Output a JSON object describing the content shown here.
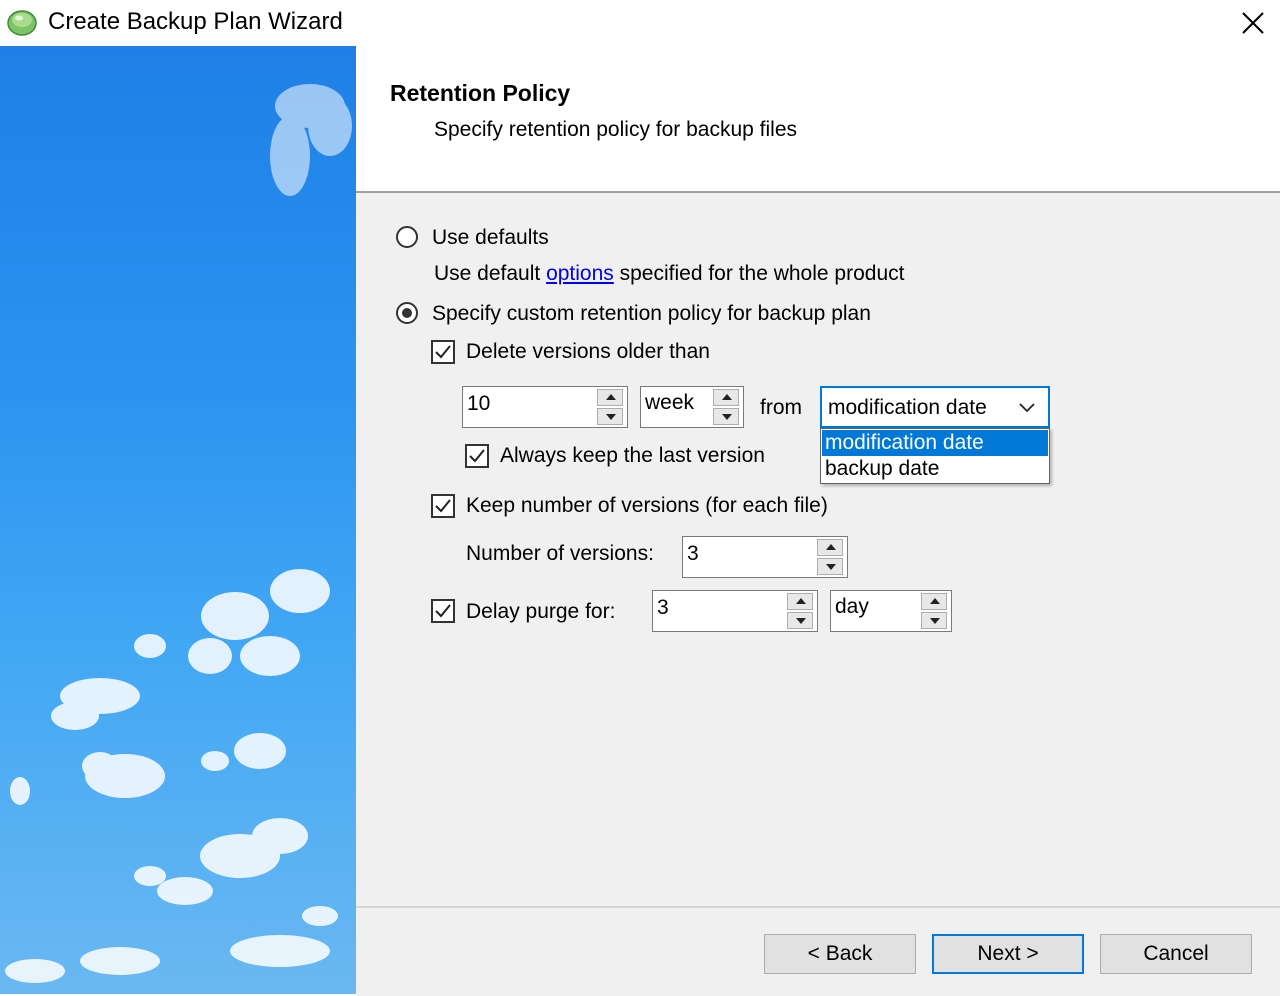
{
  "window": {
    "title": "Create Backup Plan Wizard",
    "close_icon": "close-icon"
  },
  "header": {
    "title": "Retention Policy",
    "subtitle": "Specify retention policy for backup files"
  },
  "retention": {
    "use_defaults_label": "Use defaults",
    "defaults_desc_prefix": "Use default ",
    "defaults_desc_link": "options",
    "defaults_desc_suffix": " specified for the whole product",
    "custom_label": "Specify custom retention policy for backup plan",
    "selected_option": "custom",
    "delete_versions": {
      "checked": true,
      "label": "Delete versions older than",
      "value": "10",
      "unit": "week",
      "from_label": "from",
      "from_value": "modification date"
    },
    "from_options": [
      "modification date",
      "backup date"
    ],
    "from_highlighted": "modification date",
    "keep_last": {
      "checked": true,
      "label": "Always keep the last version"
    },
    "keep_number": {
      "checked": true,
      "label": "Keep number of versions (for each file)",
      "count_label": "Number of versions:",
      "count_value": "3"
    },
    "delay_purge": {
      "checked": true,
      "label": "Delay purge for:",
      "value": "3",
      "unit": "day"
    }
  },
  "footer": {
    "back_label": "< Back",
    "next_label": "Next >",
    "cancel_label": "Cancel"
  },
  "colors": {
    "accent": "#0078d7",
    "link": "#0000ee",
    "panel_bg": "#f0f0f0",
    "sky": "#2a93f0"
  }
}
